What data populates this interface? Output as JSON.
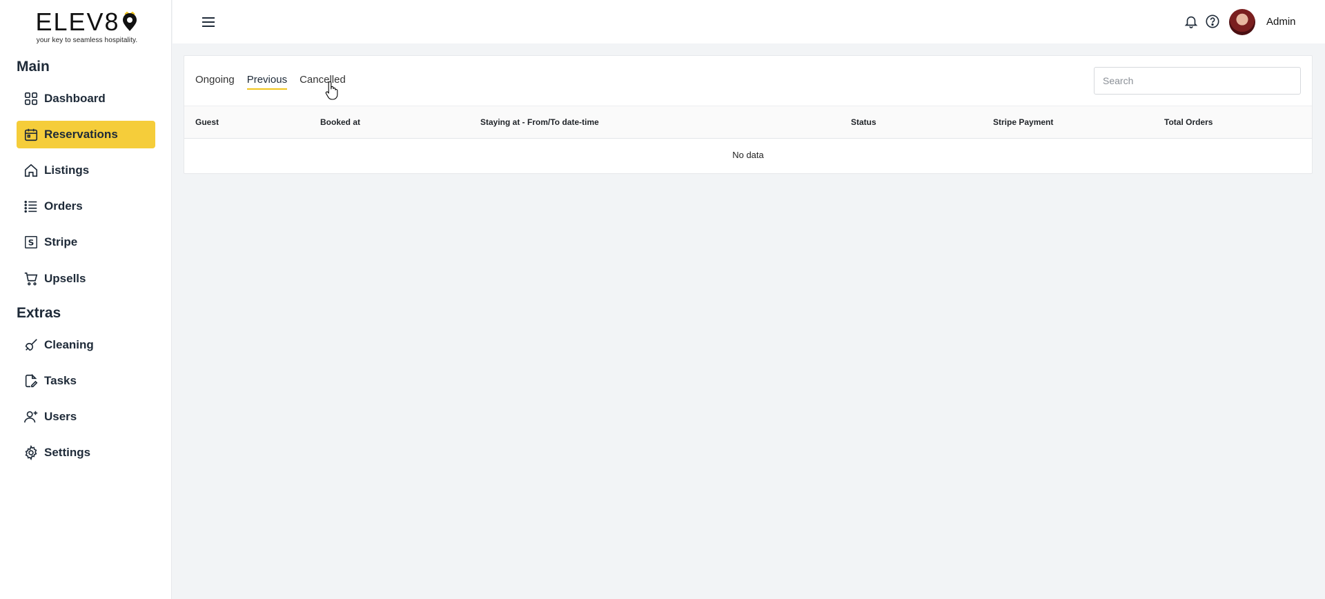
{
  "brand": {
    "name": "ELEV8",
    "tagline": "your key to seamless hospitality."
  },
  "sidebar": {
    "sections": [
      {
        "title": "Main",
        "items": [
          {
            "label": "Dashboard",
            "icon": "grid-icon"
          },
          {
            "label": "Reservations",
            "icon": "calendar-icon",
            "active": true
          },
          {
            "label": "Listings",
            "icon": "home-icon"
          },
          {
            "label": "Orders",
            "icon": "list-icon"
          },
          {
            "label": "Stripe",
            "icon": "stripe-icon"
          },
          {
            "label": "Upsells",
            "icon": "cart-icon"
          }
        ]
      },
      {
        "title": "Extras",
        "items": [
          {
            "label": "Cleaning",
            "icon": "broom-icon"
          },
          {
            "label": "Tasks",
            "icon": "task-icon"
          },
          {
            "label": "Users",
            "icon": "user-plus-icon"
          },
          {
            "label": "Settings",
            "icon": "gear-icon"
          }
        ]
      }
    ]
  },
  "topbar": {
    "user_name": "Admin",
    "icons": [
      "menu-icon",
      "bell-icon",
      "help-icon",
      "avatar"
    ]
  },
  "main": {
    "tabs": [
      {
        "label": "Ongoing"
      },
      {
        "label": "Previous",
        "active": true
      },
      {
        "label": "Cancelled"
      }
    ],
    "search": {
      "placeholder": "Search"
    },
    "table": {
      "columns": [
        "Guest",
        "Booked at",
        "Staying at - From/To date-time",
        "Status",
        "Stripe Payment",
        "Total Orders"
      ],
      "empty_text": "No data"
    }
  },
  "colors": {
    "accent": "#f5cd3a",
    "background": "#f2f4f6"
  }
}
